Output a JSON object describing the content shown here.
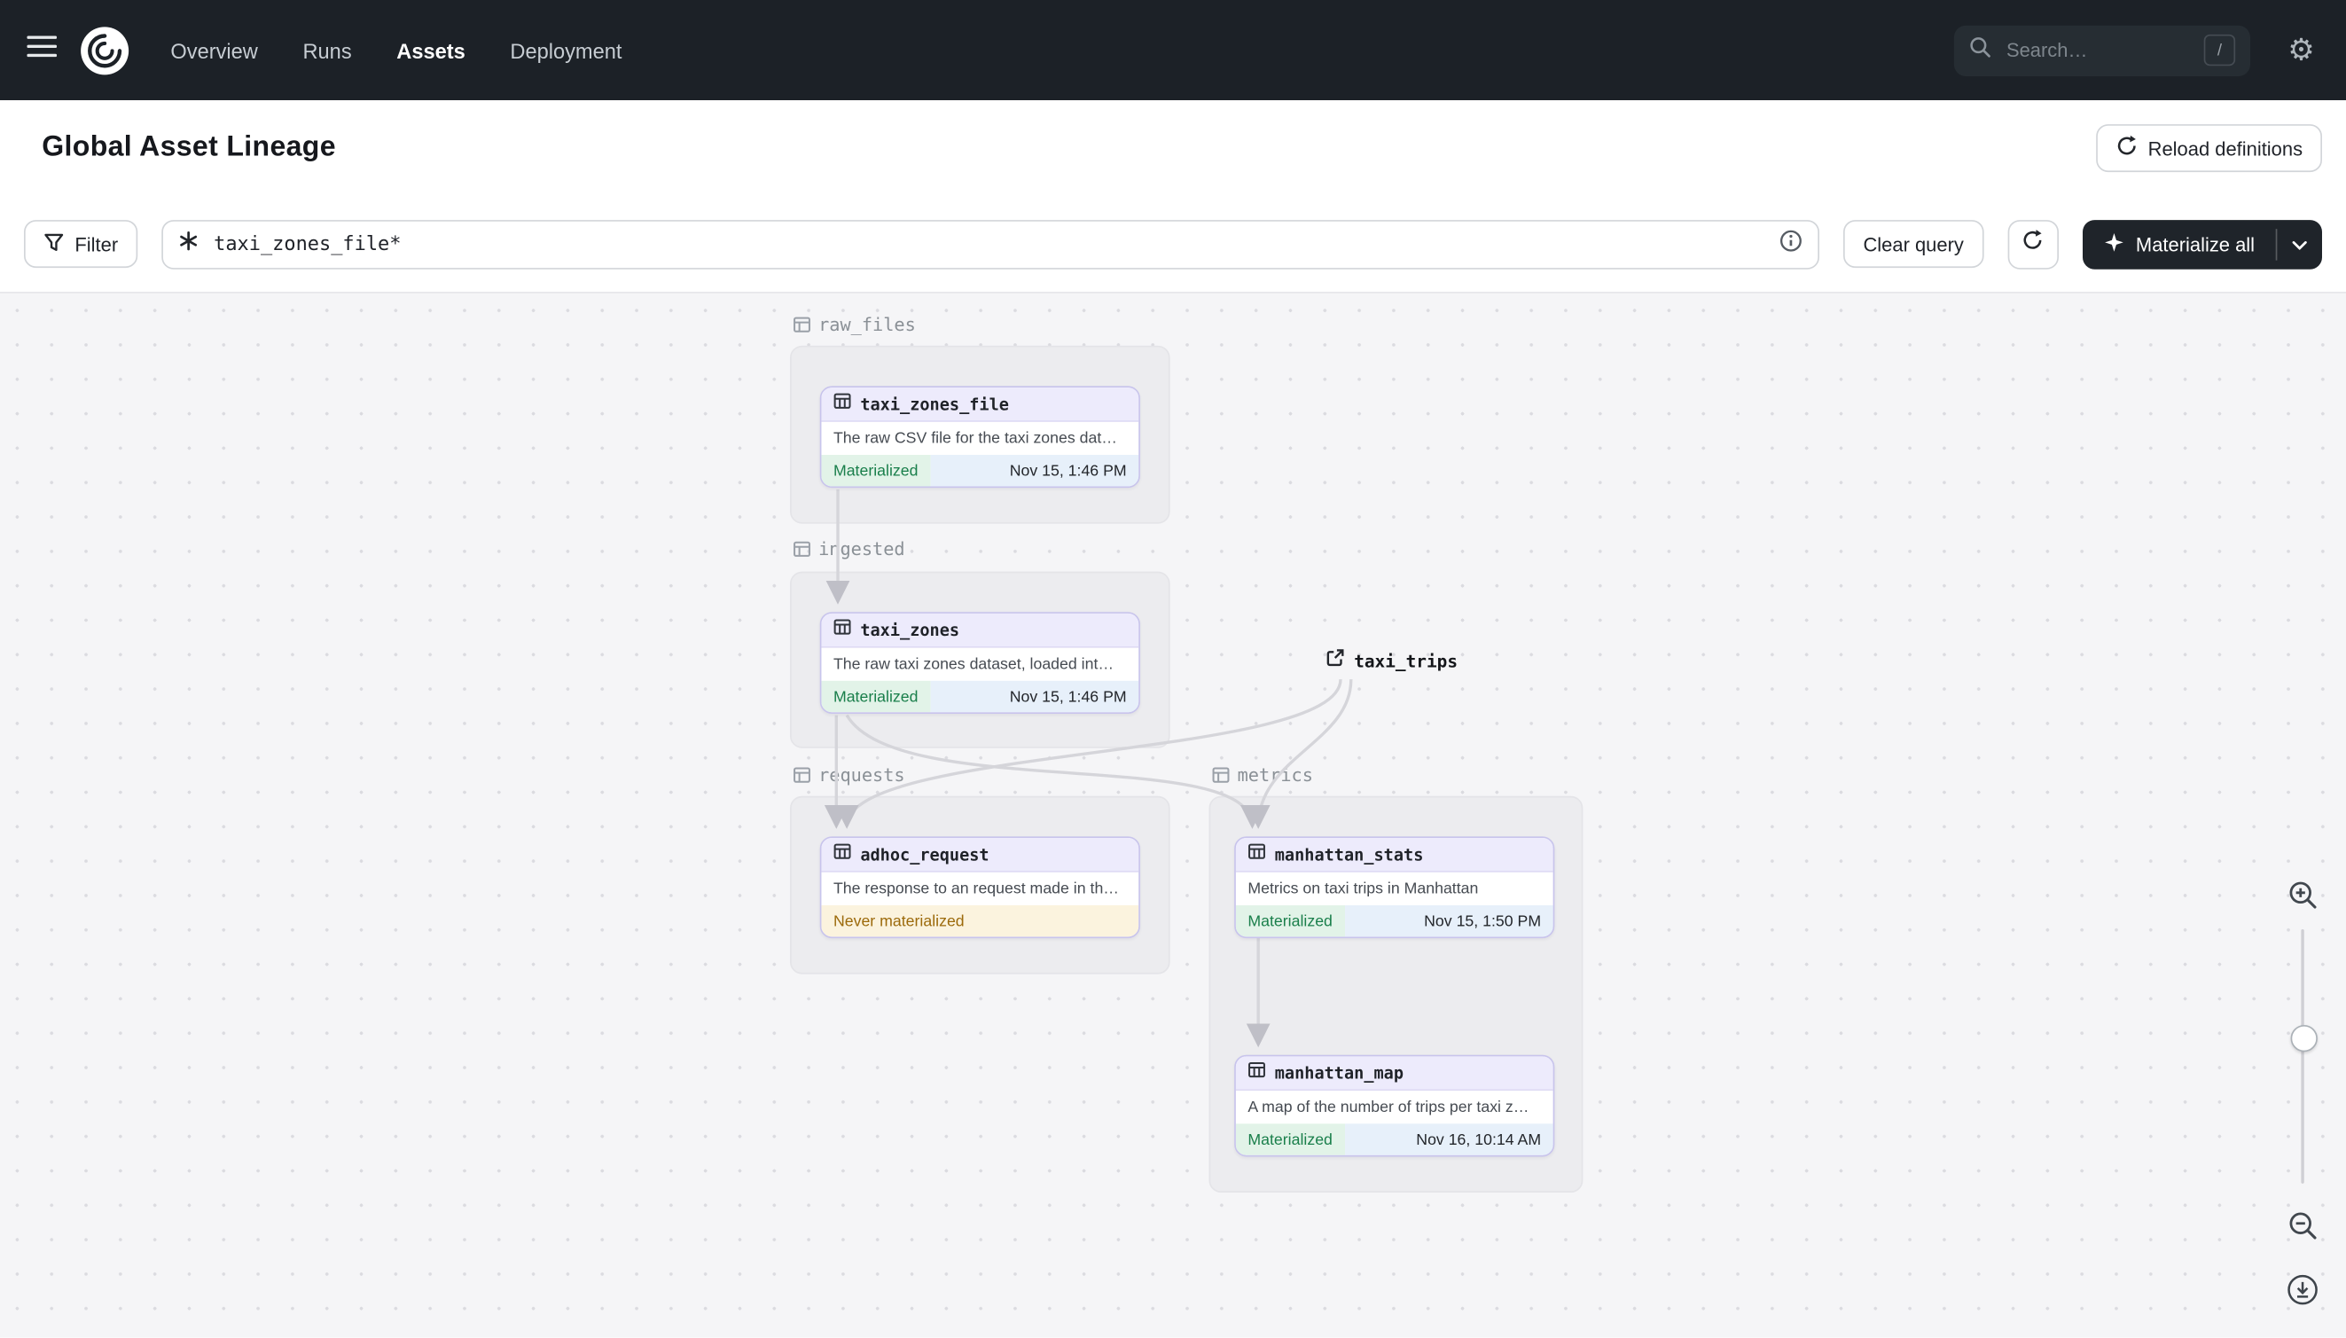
{
  "topnav": {
    "nav_items": [
      {
        "label": "Overview"
      },
      {
        "label": "Runs"
      },
      {
        "label": "Assets"
      },
      {
        "label": "Deployment"
      }
    ],
    "search_placeholder": "Search…",
    "search_shortcut": "/"
  },
  "header": {
    "title": "Global Asset Lineage",
    "reload_button": "Reload definitions"
  },
  "toolbar": {
    "filter_button": "Filter",
    "query_value": "taxi_zones_file*",
    "clear_button": "Clear query",
    "materialize_button": "Materialize all"
  },
  "canvas": {
    "groups": [
      {
        "name": "raw_files"
      },
      {
        "name": "ingested"
      },
      {
        "name": "requests"
      },
      {
        "name": "metrics"
      }
    ],
    "nodes": [
      {
        "name": "taxi_zones_file",
        "description": "The raw CSV file for the taxi zones dat…",
        "status": "Materialized",
        "timestamp": "Nov 15, 1:46 PM"
      },
      {
        "name": "taxi_zones",
        "description": "The raw taxi zones dataset, loaded int…",
        "status": "Materialized",
        "timestamp": "Nov 15, 1:46 PM"
      },
      {
        "name": "adhoc_request",
        "description": "The response to an request made in th…",
        "status": "Never materialized",
        "timestamp": ""
      },
      {
        "name": "manhattan_stats",
        "description": "Metrics on taxi trips in Manhattan",
        "status": "Materialized",
        "timestamp": "Nov 15, 1:50 PM"
      },
      {
        "name": "manhattan_map",
        "description": "A map of the number of trips per taxi z…",
        "status": "Materialized",
        "timestamp": "Nov 16, 10:14 AM"
      }
    ],
    "external_asset": {
      "name": "taxi_trips"
    }
  },
  "colors": {
    "topnav_bg": "#1C2127",
    "canvas_bg": "#F5F5F7",
    "node_border": "#C8C4EC",
    "node_header_bg": "#EDEBFC",
    "materialized_text": "#1A7F4B",
    "materialized_bg": "#E2F3E8",
    "timestamp_bg": "#E7F0FA",
    "never_materialized_text": "#9C6A0B",
    "never_materialized_bg": "#FBF3DE"
  }
}
